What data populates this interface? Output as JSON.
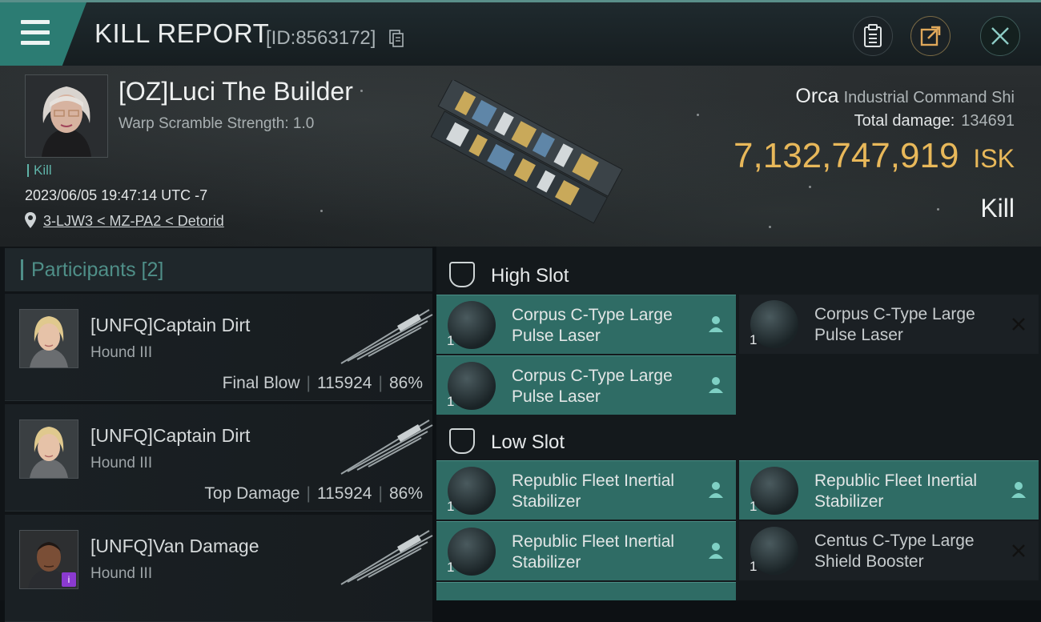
{
  "header": {
    "title": "KILL REPORT",
    "report_id": "[ID:8563172]"
  },
  "victim": {
    "name": "[OZ]Luci The Builder",
    "warp_scramble": "Warp Scramble Strength: 1.0",
    "tag": "Kill",
    "datetime": "2023/06/05 19:47:14 UTC -7",
    "location": "3-LJW3 < MZ-PA2 < Detorid",
    "ship_name": "Orca",
    "ship_class": "Industrial Command Shi",
    "total_damage_label": "Total damage:",
    "total_damage": "134691",
    "isk_value": "7,132,747,919",
    "isk_unit": "ISK",
    "result": "Kill"
  },
  "participants": {
    "title": "Participants [2]",
    "rows": [
      {
        "name": "[UNFQ]Captain Dirt",
        "ship": "Hound III",
        "role": "Final Blow",
        "damage": "115924",
        "percent": "86%"
      },
      {
        "name": "[UNFQ]Captain Dirt",
        "ship": "Hound III",
        "role": "Top Damage",
        "damage": "115924",
        "percent": "86%"
      },
      {
        "name": "[UNFQ]Van Damage",
        "ship": "Hound III",
        "role": "",
        "damage": "",
        "percent": ""
      }
    ]
  },
  "fittings": {
    "high_slot": {
      "title": "High Slot",
      "modules": [
        {
          "name": "Corpus C-Type Large Pulse Laser",
          "qty": "1",
          "status": "pilot-icon"
        },
        {
          "name": "Corpus C-Type Large Pulse Laser",
          "qty": "1",
          "status": "destroyed-icon"
        },
        {
          "name": "Corpus C-Type Large Pulse Laser",
          "qty": "1",
          "status": "pilot-icon"
        }
      ]
    },
    "low_slot": {
      "title": "Low Slot",
      "modules": [
        {
          "name": "Republic Fleet Inertial Stabilizer",
          "qty": "1",
          "status": "pilot-icon"
        },
        {
          "name": "Republic Fleet Inertial Stabilizer",
          "qty": "1",
          "status": "pilot-icon"
        },
        {
          "name": "Republic Fleet Inertial Stabilizer",
          "qty": "1",
          "status": "pilot-icon"
        },
        {
          "name": "Centus C-Type Large Shield Booster",
          "qty": "1",
          "status": "destroyed-icon"
        }
      ]
    }
  },
  "colors": {
    "accent_teal": "#2c7c73",
    "isk_gold": "#e8b85a",
    "module_active": "#2f6c65"
  }
}
